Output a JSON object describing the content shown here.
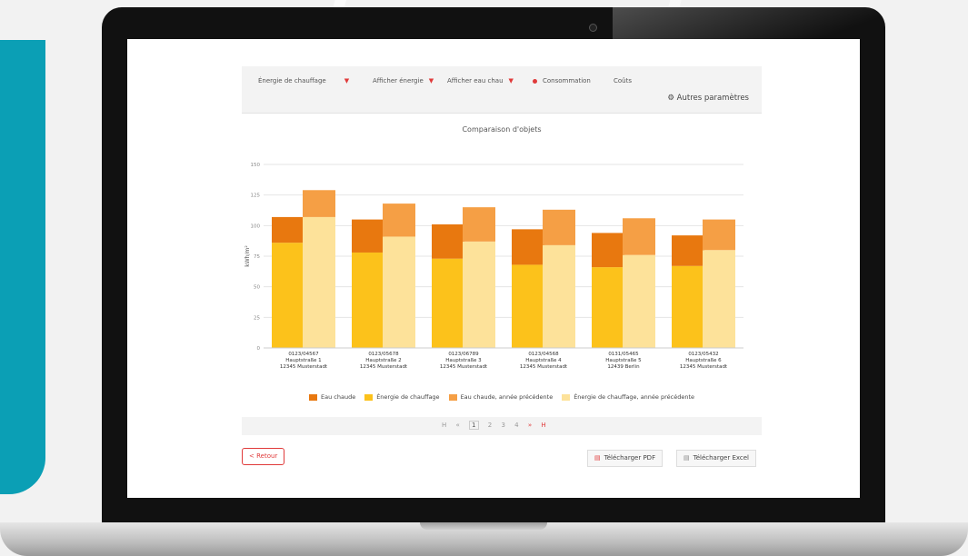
{
  "toolbar": {
    "dropdown1": "Énergie de chauffage",
    "dropdown2": "Afficher énergie",
    "dropdown3": "Afficher eau chau",
    "radio1": "Consommation",
    "radio2": "Coûts",
    "params": "Autres paramètres"
  },
  "pager": {
    "first": "H",
    "prev": "«",
    "pages": [
      "1",
      "2",
      "3",
      "4"
    ],
    "next": "»",
    "last": "H"
  },
  "buttons": {
    "back": "< Retour",
    "pdf": "Télécharger PDF",
    "excel": "Télécharger Excel"
  },
  "colors": {
    "eau_chaude": "#e8780f",
    "energie_chauffage": "#fcc21b",
    "eau_chaude_prec": "#f59f45",
    "energie_chauffage_prec": "#fde29a",
    "accent": "#e03a3a"
  },
  "chart_data": {
    "type": "bar",
    "stacked": true,
    "title": "Comparaison d'objets",
    "ylabel": "kWh/m²",
    "ylim": [
      0,
      150
    ],
    "yticks": [
      "0",
      "25",
      "50",
      "75",
      "100",
      "125",
      "150"
    ],
    "grid": true,
    "legend_position": "bottom",
    "categories": [
      [
        "0123/04567",
        "Hauptstraße 1",
        "12345 Musterstadt"
      ],
      [
        "0123/05678",
        "Hauptstraße 2",
        "12345 Musterstadt"
      ],
      [
        "0123/06789",
        "Hauptstraße 3",
        "12345 Musterstadt"
      ],
      [
        "0123/04568",
        "Hauptstraße 4",
        "12345 Musterstadt"
      ],
      [
        "0131/05465",
        "Hauptstraße 5",
        "12439 Berlin"
      ],
      [
        "0123/05432",
        "Hauptstraße 6",
        "12345 Musterstadt"
      ]
    ],
    "series": [
      {
        "name": "Eau chaude",
        "color": "#e8780f",
        "group": "current",
        "values": [
          21,
          27,
          28,
          29,
          28,
          25
        ]
      },
      {
        "name": "Énergie de chauffage",
        "color": "#fcc21b",
        "group": "current",
        "values": [
          86,
          78,
          73,
          68,
          66,
          67
        ]
      },
      {
        "name": "Eau chaude, année précédente",
        "color": "#f59f45",
        "group": "previous",
        "values": [
          22,
          27,
          28,
          29,
          30,
          25
        ]
      },
      {
        "name": "Énergie de chauffage, année précédente",
        "color": "#fde29a",
        "group": "previous",
        "values": [
          107,
          91,
          87,
          84,
          76,
          80
        ]
      }
    ]
  }
}
